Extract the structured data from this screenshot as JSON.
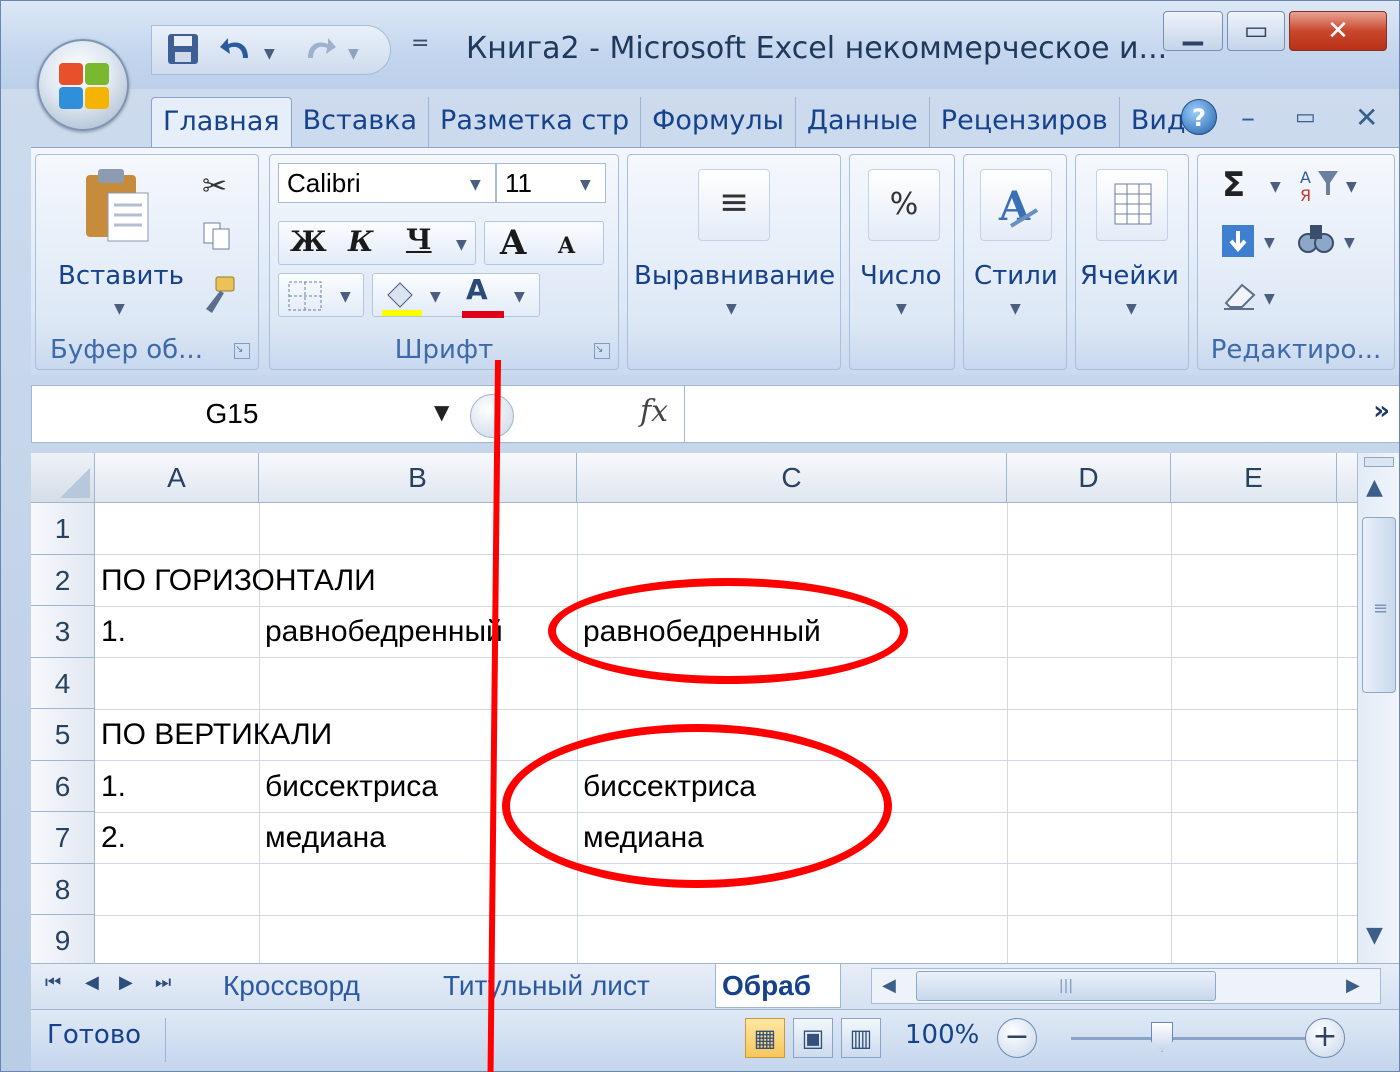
{
  "window": {
    "title": "Книга2 - Microsoft Excel некоммерческое и...",
    "controls": [
      "minimize",
      "restore",
      "close"
    ]
  },
  "qat": {
    "icons": [
      "save-icon",
      "undo-icon",
      "redo-icon"
    ],
    "customize_glyph": "="
  },
  "tabs": [
    {
      "label": "Главная",
      "active": true
    },
    {
      "label": "Вставка"
    },
    {
      "label": "Разметка стр"
    },
    {
      "label": "Формулы"
    },
    {
      "label": "Данные"
    },
    {
      "label": "Рецензиров"
    },
    {
      "label": "Вид"
    }
  ],
  "ribbon": {
    "clipboard": {
      "paste_label": "Вставить",
      "group_label": "Буфер об..."
    },
    "font": {
      "name": "Calibri",
      "size": "11",
      "bold": "Ж",
      "italic": "К",
      "underline": "Ч",
      "grow": "A",
      "shrink": "A",
      "font_color_glyph": "A",
      "group_label": "Шрифт"
    },
    "alignment_label": "Выравнивание",
    "number_label": "Число",
    "number_glyph": "%",
    "styles_label": "Стили",
    "cells_label": "Ячейки",
    "editing": {
      "sigma": "Σ",
      "group_label": "Редактиро..."
    }
  },
  "formula_bar": {
    "name_box": "G15",
    "fx": "fx",
    "value": ""
  },
  "grid": {
    "columns": [
      "A",
      "B",
      "C",
      "D",
      "E"
    ],
    "rows": [
      "1",
      "2",
      "3",
      "4",
      "5",
      "6",
      "7",
      "8",
      "9"
    ],
    "cells": {
      "A2": "ПО ГОРИЗОНТАЛИ",
      "A3": "1.",
      "B3": "равнобедренный",
      "C3": "равнобедренный",
      "A5": "ПО ВЕРТИКАЛИ",
      "A6": "1.",
      "B6": "биссектриса",
      "C6": "биссектриса",
      "A7": "2.",
      "B7": "медиана",
      "C7": "медиана"
    }
  },
  "sheet_tabs": [
    {
      "label": "Кроссворд"
    },
    {
      "label": "Титульный лист"
    },
    {
      "label": "Обраб",
      "active": true
    }
  ],
  "status": {
    "text": "Готово",
    "zoom": "100%"
  },
  "colors": {
    "annotation": "#ff0000",
    "tab_text": "#15428b"
  }
}
